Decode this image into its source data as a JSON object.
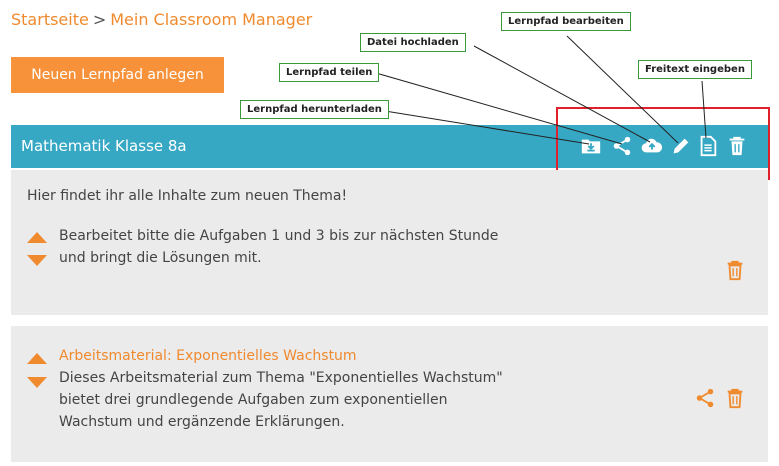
{
  "breadcrumb": {
    "home": "Startseite",
    "separator": ">",
    "current": "Mein Classroom Manager"
  },
  "actions": {
    "new_learning_path": "Neuen Lernpfad anlegen"
  },
  "learning_path": {
    "title": "Mathematik Klasse 8a",
    "toolbar_icons": [
      "download-folder-icon",
      "share-icon",
      "cloud-upload-icon",
      "pencil-icon",
      "document-icon",
      "trash-icon"
    ]
  },
  "callouts": {
    "edit": "Lernpfad bearbeiten",
    "upload": "Datei hochladen",
    "freetext": "Freitext eingeben",
    "share": "Lernpfad teilen",
    "download": "Lernpfad herunterladen"
  },
  "cards": [
    {
      "intro": "Hier findet ihr alle Inhalte zum neuen Thema!",
      "lines": [
        "Bearbeitet bitte die Aufgaben 1 und 3 bis zur nächsten Stunde",
        "und bringt die Lösungen mit."
      ]
    },
    {
      "title": "Arbeitsmaterial: Exponentielles Wachstum",
      "lines": [
        "Dieses Arbeitsmaterial zum Thema \"Exponentielles Wachstum\"",
        "bietet drei grundlegende Aufgaben zum exponentiellen",
        "Wachstum und ergänzende Erklärungen."
      ]
    }
  ],
  "colors": {
    "accent": "#f7923a",
    "header": "#37a8c4",
    "highlight": "#e0202a",
    "callout_border": "#3a9a3a",
    "card_bg": "#ebebeb"
  }
}
